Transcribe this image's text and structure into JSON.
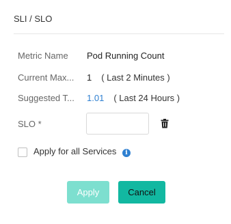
{
  "dialog": {
    "title": "SLI / SLO",
    "metric_name": {
      "label": "Metric Name",
      "value": "Pod Running Count"
    },
    "current_max": {
      "label": "Current Max...",
      "value": "1",
      "hint": "( Last 2 Minutes )"
    },
    "suggested": {
      "label": "Suggested T...",
      "value": "1.01",
      "hint": "( Last 24 Hours )"
    },
    "slo": {
      "label": "SLO *",
      "value": "",
      "placeholder": ""
    },
    "apply_all_label": "Apply for all Services",
    "apply_all_checked": false,
    "apply_button": "Apply",
    "cancel_button": "Cancel"
  },
  "icons": {
    "delete": "trash-icon",
    "info": "info-icon"
  },
  "colors": {
    "accent": "#12b8a1",
    "accent_disabled": "#7ddfcf",
    "link": "#2f80d1"
  }
}
